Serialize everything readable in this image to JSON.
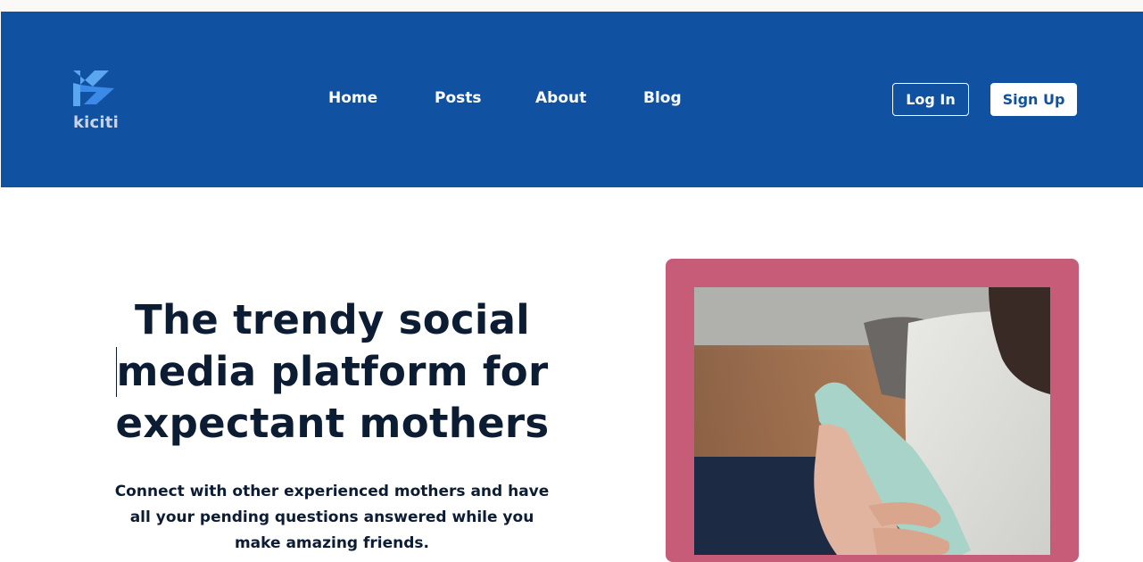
{
  "brand": {
    "name": "kiciti"
  },
  "nav": {
    "links": [
      {
        "label": "Home"
      },
      {
        "label": "Posts"
      },
      {
        "label": "About"
      },
      {
        "label": "Blog"
      }
    ],
    "login_label": "Log In",
    "signup_label": "Sign Up"
  },
  "hero": {
    "title": "The trendy social media platform for expectant mothers",
    "subtitle": "Connect with other experienced mothers and have all your pending questions answered while you make amazing friends."
  },
  "colors": {
    "nav_background": "#1052a1",
    "frame_pink": "#c75c79",
    "text_dark": "#0b1c33"
  }
}
